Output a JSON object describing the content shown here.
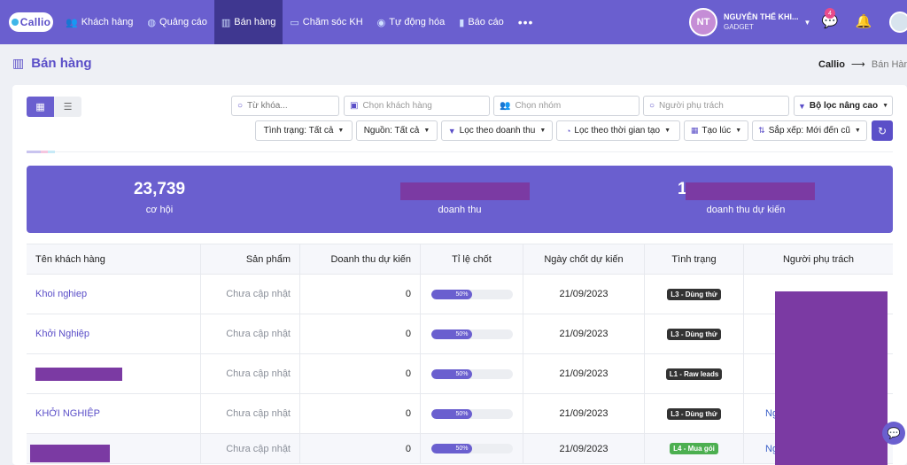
{
  "brand": {
    "logo_text": "Callio"
  },
  "nav": {
    "items": [
      {
        "label": "Khách hàng"
      },
      {
        "label": "Quảng cáo"
      },
      {
        "label": "Bán hàng"
      },
      {
        "label": "Chăm sóc KH"
      },
      {
        "label": "Tự động hóa"
      },
      {
        "label": "Báo cáo"
      }
    ],
    "more": "•••"
  },
  "user": {
    "initials": "NT",
    "name": "NGUYỄN THẾ KHI...",
    "org": "GADGET",
    "message_count": "4"
  },
  "page": {
    "title": "Bán hàng",
    "breadcrumb_home": "Callio",
    "breadcrumb_current": "Bán Hàng"
  },
  "filters": {
    "keyword_placeholder": "Từ khóa...",
    "customer_placeholder": "Chọn khách hàng",
    "group_placeholder": "Chọn nhóm",
    "owner_placeholder": "Người phụ trách",
    "advanced": "Bộ lọc nâng cao",
    "status": "Tình trạng: Tất cả",
    "source": "Nguồn: Tất cả",
    "revenue": "Lọc theo doanh thu",
    "created_time": "Lọc theo thời gian tạo",
    "created_at": "Tạo lúc",
    "sort": "Sắp xếp: Mới đến cũ"
  },
  "stats": [
    {
      "value": "23,739",
      "label": "cơ hội"
    },
    {
      "value": "",
      "label": "doanh thu"
    },
    {
      "value": "1",
      "label": "doanh thu dự kiến"
    }
  ],
  "table": {
    "headers": [
      "Tên khách hàng",
      "Sản phẩm",
      "Doanh thu dự kiến",
      "Tỉ lệ chốt",
      "Ngày chốt dự kiến",
      "Tình trạng",
      "Người phụ trách"
    ],
    "rows": [
      {
        "name": "Khoi nghiep",
        "product": "Chưa cập nhật",
        "revenue": "0",
        "rate": 50,
        "rate_label": "50%",
        "date": "21/09/2023",
        "status": "L3 - Dùng thử",
        "owner": ""
      },
      {
        "name": "Khởi Nghiệp",
        "product": "Chưa cập nhật",
        "revenue": "0",
        "rate": 50,
        "rate_label": "50%",
        "date": "21/09/2023",
        "status": "L3 - Dùng thử",
        "owner": ""
      },
      {
        "name": "",
        "product": "Chưa cập nhật",
        "revenue": "0",
        "rate": 50,
        "rate_label": "50%",
        "date": "21/09/2023",
        "status": "L1 - Raw leads",
        "owner": ""
      },
      {
        "name": "KHỞI NGHIỆP",
        "product": "Chưa cập nhật",
        "revenue": "0",
        "rate": 50,
        "rate_label": "50%",
        "date": "21/09/2023",
        "status": "L3 - Dùng thử",
        "owner": "Ng"
      },
      {
        "name": "",
        "product": "Chưa cập nhật",
        "revenue": "0",
        "rate": 50,
        "rate_label": "50%",
        "date": "21/09/2023",
        "status": "L4 - Mua gói",
        "owner": "Ng"
      }
    ]
  },
  "colors": {
    "primary": "#6a5fcf",
    "nav_active": "#3f3790",
    "status_green": "#4caf50",
    "redaction": "#7b3aa3"
  }
}
